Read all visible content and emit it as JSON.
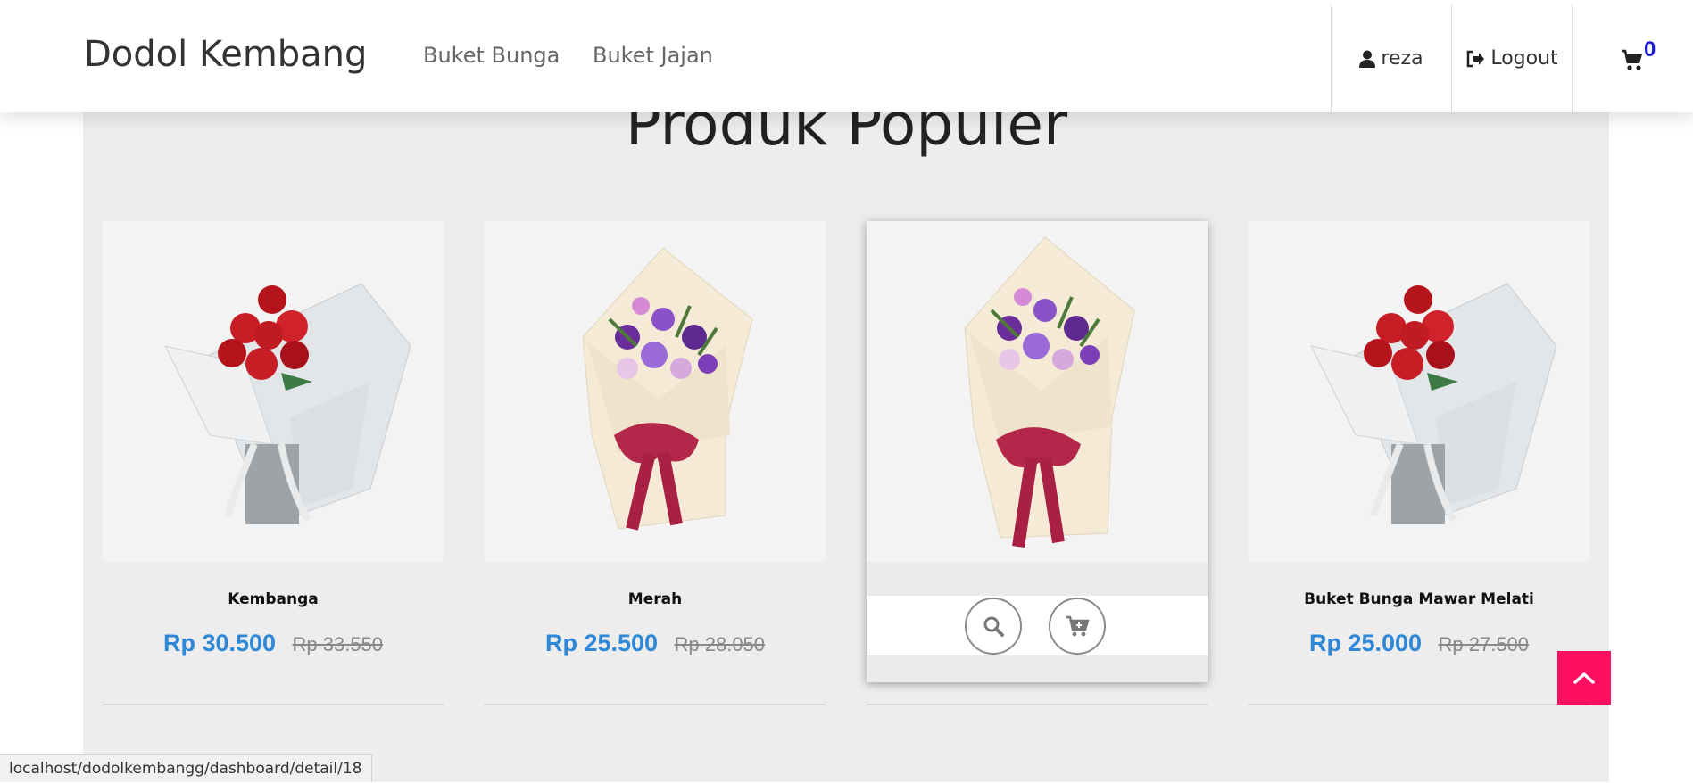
{
  "brand": "Dodol Kembang",
  "nav": {
    "links": [
      "Buket Bunga",
      "Buket Jajan"
    ]
  },
  "user": {
    "name": "reza",
    "logout_label": "Logout"
  },
  "cart": {
    "count": "0"
  },
  "section": {
    "title": "Produk Populer"
  },
  "products": [
    {
      "name": "Kembanga",
      "price": "Rp 30.500",
      "old_price": "Rp 33.550",
      "image": "red-rose-bouquet"
    },
    {
      "name": "Merah",
      "price": "Rp 25.500",
      "old_price": "Rp 28.050",
      "image": "purple-flower-bouquet"
    },
    {
      "name": "",
      "price": "",
      "old_price": "",
      "image": "purple-flower-bouquet"
    },
    {
      "name": "Buket Bunga Mawar Melati",
      "price": "Rp 25.000",
      "old_price": "Rp 27.500",
      "image": "red-rose-bouquet"
    }
  ],
  "hover_actions": {
    "view_icon": "search-icon",
    "add_icon": "cart-plus-icon"
  },
  "status_url": "localhost/dodolkembangg/dashboard/detail/18",
  "colors": {
    "accent_price": "#2f87d8",
    "back_to_top": "#ff0f5f",
    "cart_count": "#1c1cd6"
  }
}
